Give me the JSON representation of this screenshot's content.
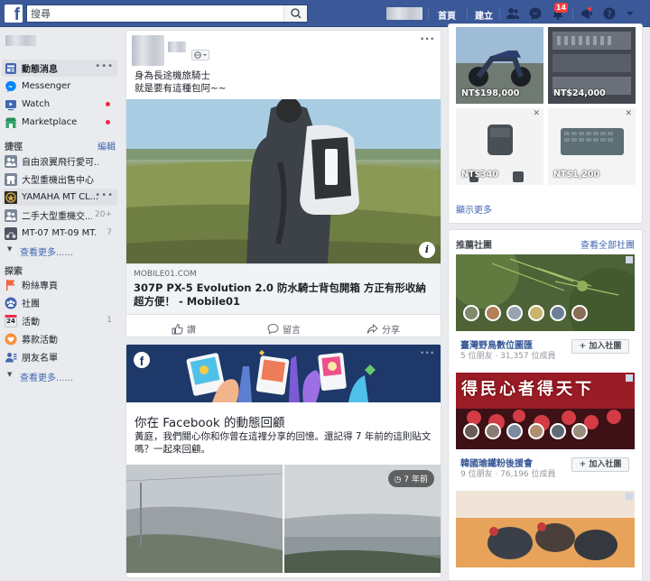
{
  "topbar": {
    "search_placeholder": "搜尋",
    "home_label": "首頁",
    "create_label": "建立",
    "notification_count": "14",
    "colors": {
      "bar": "#3b5998",
      "badge": "#fa3e3e"
    }
  },
  "left_nav": {
    "main_items": [
      {
        "label": "動態消息",
        "icon": "news-feed-icon"
      },
      {
        "label": "Messenger",
        "icon": "messenger-icon"
      },
      {
        "label": "Watch",
        "icon": "watch-icon"
      },
      {
        "label": "Marketplace",
        "icon": "marketplace-icon"
      }
    ],
    "shortcuts_title": "捷徑",
    "edit_label": "編輯",
    "shortcuts": [
      {
        "label": "自由浪翼飛行愛可..."
      },
      {
        "label": "大型重機出售中心"
      },
      {
        "label": "YAMAHA MT CL..."
      },
      {
        "label": "二手大型重機交...",
        "count": "20+"
      },
      {
        "label": "MT-07 MT-09 MT...",
        "count": "7"
      }
    ],
    "see_more_label": "查看更多......",
    "explore_title": "探索",
    "explore": [
      {
        "label": "粉絲專頁",
        "icon": "flag-icon"
      },
      {
        "label": "社團",
        "icon": "groups-icon"
      },
      {
        "label": "活動",
        "icon": "calendar-icon",
        "count": "1",
        "calendar_day": "24"
      },
      {
        "label": "募款活動",
        "icon": "fundraiser-icon"
      },
      {
        "label": "朋友名單",
        "icon": "friends-list-icon"
      }
    ],
    "explore_see_more_label": "查看更多......"
  },
  "post": {
    "text": "身為長途機旅騎士\n就是要有這種包阿~~",
    "link_domain": "MOBILE01.COM",
    "link_title": "307P PX-5 Evolution 2.0 防水騎士背包開箱 方正有形收納超方便！ - Mobile01",
    "actions": [
      "讚",
      "留言",
      "分享"
    ]
  },
  "memory": {
    "title": "你在 Facebook 的動態回顧",
    "description": "黃庭，我們關心你和你曾在這裡分享的回憶。還記得 7 年前的這則貼文嗎？一起來回顧。",
    "time_badge": "7 年前"
  },
  "marketplace": {
    "prices": [
      "NT$198,000",
      "NT$24,000",
      "NT$340",
      "NT$1,200"
    ],
    "see_more_label": "顯示更多"
  },
  "groups": {
    "header": "推薦社團",
    "see_all_label": "查看全部社團",
    "join_label": "加入社團",
    "items": [
      {
        "name": "臺灣野鳥數位圖匯",
        "meta": "5 位朋友 · 31,357 位成員"
      },
      {
        "name": "韓國瑜鐵粉後援會",
        "meta": "9 位朋友 · 76,196 位成員",
        "cover_text": "得民心者得天下"
      }
    ]
  }
}
